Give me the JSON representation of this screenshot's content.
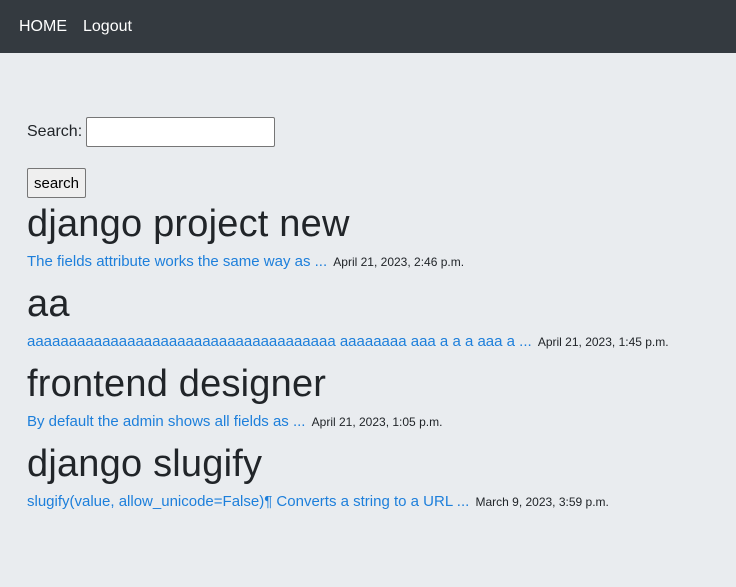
{
  "nav": {
    "home": "HOME",
    "logout": "Logout"
  },
  "search": {
    "label": "Search:",
    "value": "",
    "placeholder": "",
    "button_label": "search"
  },
  "posts": [
    {
      "title": "django project new",
      "excerpt": "The fields attribute works the same way as ...",
      "date": "April 21, 2023, 2:46 p.m."
    },
    {
      "title": "aa",
      "excerpt": "aaaaaaaaaaaaaaaaaaaaaaaaaaaaaaaaaaaaa aaaaaaaa aaa a a a aaa a ...",
      "date": "April 21, 2023, 1:45 p.m."
    },
    {
      "title": "frontend designer",
      "excerpt": "By default the admin shows all fields as ...",
      "date": "April 21, 2023, 1:05 p.m."
    },
    {
      "title": "django slugify",
      "excerpt": "slugify(value, allow_unicode=False)¶ Converts a string to a URL ...",
      "date": "March 9, 2023, 3:59 p.m."
    }
  ],
  "colors": {
    "navbar": "#343a40",
    "page_background": "#e9ecef",
    "link": "#1d7fdb"
  }
}
